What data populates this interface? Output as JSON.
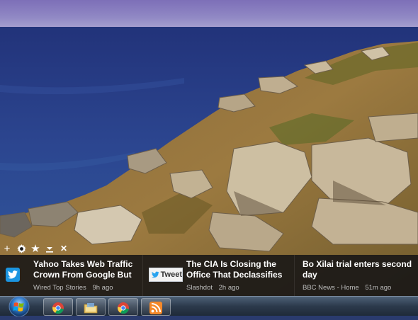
{
  "toolbar": {
    "buttons": [
      {
        "name": "add",
        "glyph": "+"
      },
      {
        "name": "settings"
      },
      {
        "name": "favorite",
        "glyph": "★"
      },
      {
        "name": "minimize"
      },
      {
        "name": "close",
        "glyph": "✕"
      }
    ]
  },
  "ticker": {
    "stories": [
      {
        "title": "Yahoo Takes Web Traffic Crown From Google  But Is",
        "source": "Wired Top Stories",
        "age": "9h ago",
        "thumb": "twitter-bird-icon"
      },
      {
        "title": "The CIA Is Closing the Office That Declassifies",
        "source": "Slashdot",
        "age": "2h ago",
        "thumb": "tweet-button",
        "badge_label": "Tweet"
      },
      {
        "title": "Bo Xilai trial enters second day",
        "source": "BBC News - Home",
        "age": "51m ago"
      }
    ]
  },
  "taskbar": {
    "apps": [
      {
        "name": "chrome",
        "icon": "chrome-icon"
      },
      {
        "name": "explorer",
        "icon": "folder-icon"
      },
      {
        "name": "chrome",
        "icon": "chrome-icon"
      },
      {
        "name": "rss",
        "icon": "rss-icon"
      }
    ]
  }
}
